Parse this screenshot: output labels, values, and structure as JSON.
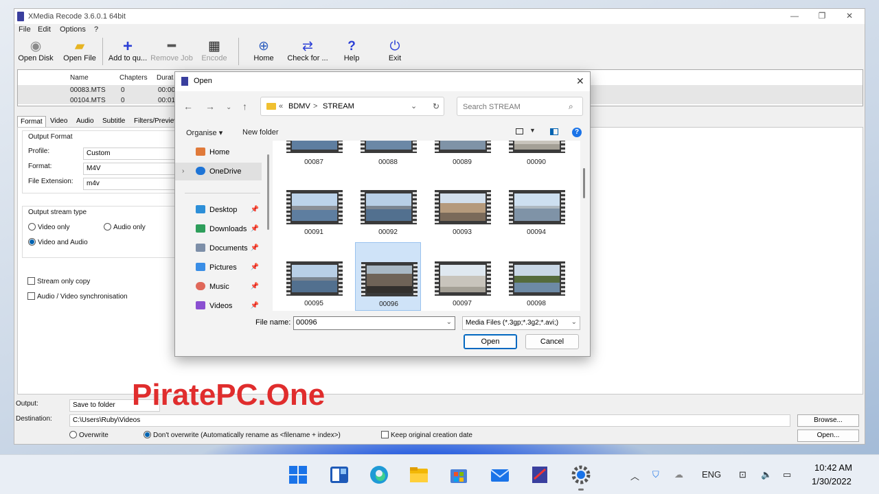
{
  "app": {
    "title": "XMedia Recode 3.6.0.1 64bit",
    "window_controls": {
      "minimize": "—",
      "maximize": "❐",
      "close": "✕"
    },
    "menu": [
      "File",
      "Edit",
      "Options",
      "?"
    ],
    "toolbar": [
      {
        "label": "Open Disk",
        "icon": "disc-icon",
        "enabled": true
      },
      {
        "label": "Open File",
        "icon": "folder-icon",
        "enabled": true
      },
      {
        "label": "Add to qu...",
        "icon": "plus-icon",
        "enabled": true
      },
      {
        "label": "Remove Job",
        "icon": "minus-icon",
        "enabled": false
      },
      {
        "label": "Encode",
        "icon": "clapper-icon",
        "enabled": false
      },
      {
        "label": "Home",
        "icon": "globe-icon",
        "enabled": true
      },
      {
        "label": "Check for ...",
        "icon": "refresh-icon",
        "enabled": true
      },
      {
        "label": "Help",
        "icon": "question-icon",
        "enabled": true
      },
      {
        "label": "Exit",
        "icon": "power-icon",
        "enabled": true
      }
    ],
    "file_list": {
      "columns": [
        "Name",
        "Chapters",
        "Durat"
      ],
      "rows": [
        {
          "name": "00083.MTS",
          "chapters": "0",
          "duration": "00:00"
        },
        {
          "name": "00104.MTS",
          "chapters": "0",
          "duration": "00:01"
        }
      ]
    },
    "tabs": [
      "Format",
      "Video",
      "Audio",
      "Subtitle",
      "Filters/Preview"
    ],
    "format": {
      "output_format_title": "Output Format",
      "profile_label": "Profile:",
      "profile_value": "Custom",
      "format_label": "Format:",
      "format_value": "M4V",
      "ext_label": "File Extension:",
      "ext_value": "m4v",
      "stream_type_title": "Output stream type",
      "video_only": "Video only",
      "audio_only": "Audio only",
      "video_and_audio": "Video and Audio",
      "stream_copy": "Stream only copy",
      "av_sync": "Audio / Video synchronisation"
    },
    "bottom": {
      "output_label": "Output:",
      "output_value": "Save to folder",
      "destination_label": "Destination:",
      "destination_value": "C:\\Users\\Ruby\\Videos",
      "browse": "Browse...",
      "open": "Open...",
      "overwrite": "Overwrite",
      "dont_overwrite": "Don't overwrite (Automatically rename as <filename + index>)",
      "keep_date": "Keep original creation date"
    }
  },
  "dialog": {
    "title": "Open",
    "path": [
      "«",
      "BDMV",
      ">",
      "STREAM"
    ],
    "search_placeholder": "Search STREAM",
    "organise": "Organise ▾",
    "new_folder": "New folder",
    "sidebar": [
      {
        "label": "Home",
        "icon": "home-icon",
        "color": "#e07a3a",
        "pinned": false
      },
      {
        "label": "OneDrive",
        "icon": "cloud-icon",
        "color": "#1e74d6",
        "pinned": false
      },
      {
        "label": "Desktop",
        "icon": "desktop-icon",
        "color": "#2d8fd8",
        "pinned": true
      },
      {
        "label": "Downloads",
        "icon": "download-icon",
        "color": "#2e9e5b",
        "pinned": true
      },
      {
        "label": "Documents",
        "icon": "documents-icon",
        "color": "#7d8fa8",
        "pinned": true
      },
      {
        "label": "Pictures",
        "icon": "pictures-icon",
        "color": "#3a8ee6",
        "pinned": true
      },
      {
        "label": "Music",
        "icon": "music-icon",
        "color": "#e0685a",
        "pinned": true
      },
      {
        "label": "Videos",
        "icon": "videos-icon",
        "color": "#8a4fd1",
        "pinned": true
      }
    ],
    "files": [
      "00087",
      "00088",
      "00089",
      "00090",
      "00091",
      "00092",
      "00093",
      "00094",
      "00095",
      "00096",
      "00097",
      "00098"
    ],
    "selected": "00096",
    "file_name_label": "File name:",
    "file_name_value": "00096",
    "file_type_value": "Media Files (*.3gp;*.3g2;*.avi;)",
    "open_btn": "Open",
    "cancel_btn": "Cancel"
  },
  "watermark": "PiratePC.One",
  "taskbar": {
    "lang": "ENG",
    "time": "10:42 AM",
    "date": "1/30/2022"
  }
}
